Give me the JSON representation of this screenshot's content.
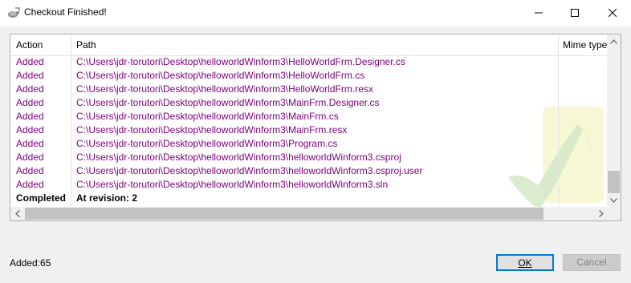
{
  "window": {
    "title": "Checkout Finished!",
    "icon": "tortoise-icon"
  },
  "table": {
    "columns": [
      "Action",
      "Path",
      "Mime type"
    ],
    "rows": [
      {
        "action": "Added",
        "path": "C:\\Users\\jdr-torutori\\Desktop\\helloworldWinform3\\HelloWorldFrm.Designer.cs"
      },
      {
        "action": "Added",
        "path": "C:\\Users\\jdr-torutori\\Desktop\\helloworldWinform3\\HelloWorldFrm.cs"
      },
      {
        "action": "Added",
        "path": "C:\\Users\\jdr-torutori\\Desktop\\helloworldWinform3\\HelloWorldFrm.resx"
      },
      {
        "action": "Added",
        "path": "C:\\Users\\jdr-torutori\\Desktop\\helloworldWinform3\\MainFrm.Designer.cs"
      },
      {
        "action": "Added",
        "path": "C:\\Users\\jdr-torutori\\Desktop\\helloworldWinform3\\MainFrm.cs"
      },
      {
        "action": "Added",
        "path": "C:\\Users\\jdr-torutori\\Desktop\\helloworldWinform3\\MainFrm.resx"
      },
      {
        "action": "Added",
        "path": "C:\\Users\\jdr-torutori\\Desktop\\helloworldWinform3\\Program.cs"
      },
      {
        "action": "Added",
        "path": "C:\\Users\\jdr-torutori\\Desktop\\helloworldWinform3\\helloworldWinform3.csproj"
      },
      {
        "action": "Added",
        "path": "C:\\Users\\jdr-torutori\\Desktop\\helloworldWinform3\\helloworldWinform3.csproj.user"
      },
      {
        "action": "Added",
        "path": "C:\\Users\\jdr-torutori\\Desktop\\helloworldWinform3\\helloworldWinform3.sln"
      },
      {
        "action": "Completed",
        "path": "At revision: 2"
      }
    ]
  },
  "status": {
    "summary": "Added:65"
  },
  "buttons": {
    "ok": "OK",
    "cancel": "Cancel"
  },
  "colors": {
    "added_text": "#800080",
    "focus_border": "#0078d7"
  }
}
